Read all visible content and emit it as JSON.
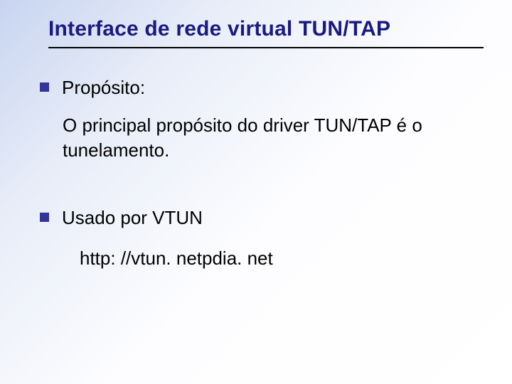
{
  "title": "Interface de rede virtual TUN/TAP",
  "bullets": [
    {
      "label": "Propósito:"
    },
    {
      "label": "Usado por VTUN"
    }
  ],
  "paragraph": "O principal propósito do driver TUN/TAP é o tunelamento.",
  "sublink": "http: //vtun. netpdia. net"
}
